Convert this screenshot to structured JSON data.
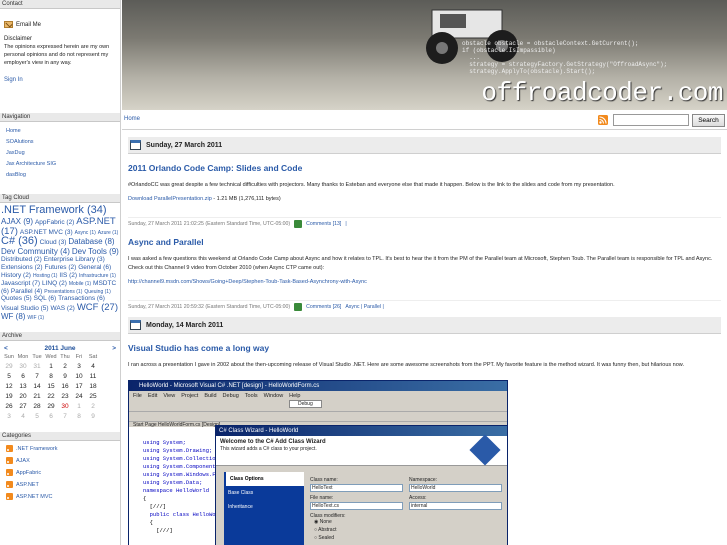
{
  "sidebar": {
    "contact": {
      "heading": "Contact",
      "email_label": "Email Me",
      "disclaimer_title": "Disclaimer",
      "disclaimer_text": "The opinions expressed herein are my own personal opinions and do not represent my employer's view in any way.",
      "signin": "Sign In"
    },
    "navigation": {
      "heading": "Navigation",
      "items": [
        "Home",
        "SOAlutions",
        "JaxDug",
        "Jax Architecture SIG",
        "dasBlog"
      ]
    },
    "tag_cloud": {
      "heading": "Tag Cloud",
      "tags": [
        {
          "text": ".NET Framework (34)",
          "w": 5
        },
        {
          "text": "AJAX (9)",
          "w": 3
        },
        {
          "text": "AppFabric (2)",
          "w": 2
        },
        {
          "text": "ASP.NET (17)",
          "w": 4
        },
        {
          "text": "ASP.NET MVC (3)",
          "w": 2
        },
        {
          "text": "Async (1)",
          "w": 1
        },
        {
          "text": "Azure (1)",
          "w": 1
        },
        {
          "text": "C# (36)",
          "w": 5
        },
        {
          "text": "Cloud (3)",
          "w": 2
        },
        {
          "text": "Database (8)",
          "w": 3
        },
        {
          "text": "Dev Community (4)",
          "w": 3
        },
        {
          "text": "Dev Tools (9)",
          "w": 3
        },
        {
          "text": "Distributed (2)",
          "w": 2
        },
        {
          "text": "Enterprise Library (3)",
          "w": 2
        },
        {
          "text": "Extensions (2)",
          "w": 2
        },
        {
          "text": "Futures (2)",
          "w": 2
        },
        {
          "text": "General (6)",
          "w": 2
        },
        {
          "text": "History (2)",
          "w": 2
        },
        {
          "text": "Hosting (1)",
          "w": 1
        },
        {
          "text": "IIS (2)",
          "w": 2
        },
        {
          "text": "Infrastructure (1)",
          "w": 1
        },
        {
          "text": "Javascript (7)",
          "w": 2
        },
        {
          "text": "LINQ (2)",
          "w": 2
        },
        {
          "text": "Mobile (1)",
          "w": 1
        },
        {
          "text": "MSDTC (6)",
          "w": 2
        },
        {
          "text": "Parallel (4)",
          "w": 2
        },
        {
          "text": "Presentations (1)",
          "w": 1
        },
        {
          "text": "Queuing (1)",
          "w": 1
        },
        {
          "text": "Quotes (5)",
          "w": 2
        },
        {
          "text": "SQL (6)",
          "w": 2
        },
        {
          "text": "Transactions (6)",
          "w": 2
        },
        {
          "text": "Visual Studio (5)",
          "w": 2
        },
        {
          "text": "WAS (2)",
          "w": 2
        },
        {
          "text": "WCF (27)",
          "w": 4
        },
        {
          "text": "WF (8)",
          "w": 3
        },
        {
          "text": "WIF (1)",
          "w": 1
        }
      ]
    },
    "archive": {
      "heading": "Archive",
      "prev": "<",
      "next": ">",
      "month_label": "2011 June",
      "weekdays": [
        "Sun",
        "Mon",
        "Tue",
        "Wed",
        "Thu",
        "Fri",
        "Sat"
      ],
      "weeks": [
        [
          {
            "d": "29",
            "om": true
          },
          {
            "d": "30",
            "om": true
          },
          {
            "d": "31",
            "om": true
          },
          {
            "d": "1"
          },
          {
            "d": "2"
          },
          {
            "d": "3"
          },
          {
            "d": "4"
          }
        ],
        [
          {
            "d": "5"
          },
          {
            "d": "6"
          },
          {
            "d": "7"
          },
          {
            "d": "8"
          },
          {
            "d": "9"
          },
          {
            "d": "10"
          },
          {
            "d": "11"
          }
        ],
        [
          {
            "d": "12"
          },
          {
            "d": "13"
          },
          {
            "d": "14"
          },
          {
            "d": "15"
          },
          {
            "d": "16"
          },
          {
            "d": "17"
          },
          {
            "d": "18"
          }
        ],
        [
          {
            "d": "19"
          },
          {
            "d": "20"
          },
          {
            "d": "21"
          },
          {
            "d": "22"
          },
          {
            "d": "23"
          },
          {
            "d": "24"
          },
          {
            "d": "25"
          }
        ],
        [
          {
            "d": "26"
          },
          {
            "d": "27"
          },
          {
            "d": "28"
          },
          {
            "d": "29"
          },
          {
            "d": "30",
            "today": true
          },
          {
            "d": "1",
            "om": true
          },
          {
            "d": "2",
            "om": true
          }
        ],
        [
          {
            "d": "3",
            "om": true
          },
          {
            "d": "4",
            "om": true
          },
          {
            "d": "5",
            "om": true
          },
          {
            "d": "6",
            "om": true
          },
          {
            "d": "7",
            "om": true
          },
          {
            "d": "8",
            "om": true
          },
          {
            "d": "9",
            "om": true
          }
        ]
      ]
    },
    "categories": {
      "heading": "Categories",
      "items": [
        ".NET Framework",
        "AJAX",
        "AppFabric",
        "ASP.NET",
        "ASP.NET MVC"
      ]
    }
  },
  "header": {
    "brand": "offroadcoder.com",
    "code_text": "obstacle obstacle = obstacleContext.GetCurrent();\nif (obstacle.IsImpassible)\n  ...\n  strategy = strategyFactory.GetStrategy(\"OffroadAsync\");\n  strategy.ApplyTo(obstacle).Start();"
  },
  "topbar": {
    "home": "Home",
    "search_value": "",
    "search_button": "Search"
  },
  "days": [
    {
      "date": "Sunday, 27 March 2011",
      "posts": [
        {
          "title": "2011 Orlando Code Camp: Slides and Code",
          "body": "#OrlandoCC was great despite a few technical difficulties with projectors. Many thanks to Esteban and everyone else that made it happen. Below is the link to the slides and code from my presentation.",
          "link_text": "Download ParallelPresentation.zip",
          "link_suffix": " - 1.21 MB (1,276,111 bytes)",
          "footer_time": "Sunday, 27 March 2011 21:02:25 (Eastern Standard Time, UTC-05:00)",
          "footer_comments": "Comments [13]",
          "footer_cats": "|"
        },
        {
          "title": "Async and Parallel",
          "body": "I was asked a few questions this weekend at Orlando Code Camp about Async and how it relates to TPL. It's best to hear the it from the PM of the Parallel team at Microsoft, Stephen Toub. The Parallel team is responsible for TPL and Async. Check out this Channel 9 video from October 2010 (when Async CTP came out):",
          "link_text": "http://channel9.msdn.com/Shows/Going+Deep/Stephen-Toub-Task-Based-Asynchrony-with-Async",
          "link_suffix": "",
          "footer_time": "Sunday, 27 March 2011 20:59:32 (Eastern Standard Time, UTC-05:00)",
          "footer_comments": "Comments [26]",
          "footer_cats": "Async | Parallel |"
        }
      ]
    },
    {
      "date": "Monday, 14 March 2011",
      "posts": [
        {
          "title": "Visual Studio has come a long way",
          "body": "I ran across a presentation I gave in 2002 about the then-upcoming release of Visual Studio .NET. Here are some awesome screenshots from the PPT. My favorite feature is the method wizard. It was funny then, but hilarious now."
        }
      ]
    }
  ],
  "vs_image": {
    "window_title": "HelloWorld - Microsoft Visual C# .NET [design] - HelloWorldForm.cs",
    "menu": [
      "File",
      "Edit",
      "View",
      "Project",
      "Build",
      "Debug",
      "Tools",
      "Window",
      "Help"
    ],
    "debug_select": "Debug",
    "tab_label": "Start Page  HelloWorldForm.cs [Design]",
    "code_lines": [
      "using System;",
      "using System.Drawing;",
      "using System.Collections;",
      "using System.ComponentModel;",
      "using System.Windows.Forms;",
      "using System.Data;",
      "",
      "namespace HelloWorld",
      "{",
      "  [///]",
      "  public class HelloWorld",
      "  {",
      "    [///]"
    ],
    "wizard": {
      "title": "C# Class Wizard - HelloWorld",
      "welcome": "Welcome to the C# Add Class Wizard",
      "subtitle": "This wizard adds a C# class to your project.",
      "side_items": [
        "Class Options",
        "Base Class",
        "Inheritance"
      ],
      "class_name_label": "Class name:",
      "class_name_value": "HelloText",
      "namespace_label": "Namespace:",
      "namespace_value": "HelloWorld",
      "file_name_label": "File name:",
      "file_name_value": "HelloText.cs",
      "access_label": "Access:",
      "access_value": "internal",
      "modifiers_label": "Class modifiers:",
      "modifiers": [
        "None",
        "Abstract",
        "Sealed"
      ]
    }
  }
}
